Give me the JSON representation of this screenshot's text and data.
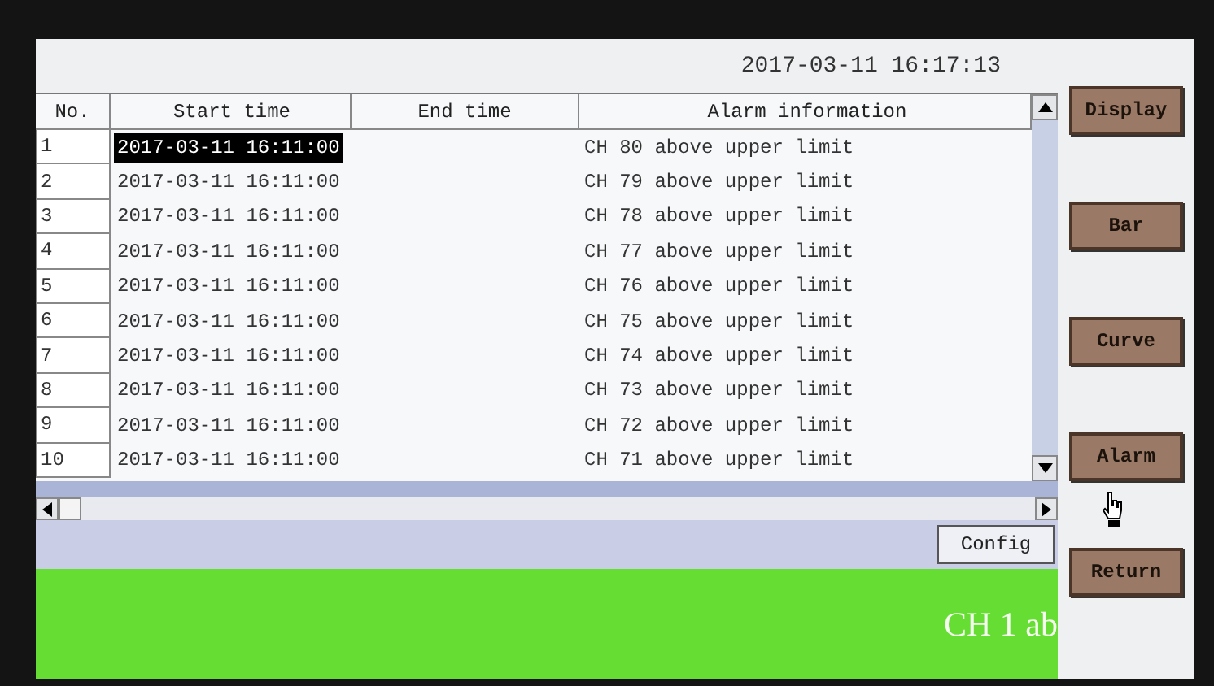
{
  "datetime": "2017-03-11 16:17:13",
  "table": {
    "columns": [
      "No.",
      "Start time",
      "End time",
      "Alarm information"
    ],
    "rows": [
      {
        "no": "1",
        "start": "2017-03-11 16:11:00",
        "info": "CH 80 above upper limit",
        "selected": true
      },
      {
        "no": "2",
        "start": "2017-03-11 16:11:00",
        "info": "CH 79 above upper limit",
        "selected": false
      },
      {
        "no": "3",
        "start": "2017-03-11 16:11:00",
        "info": "CH 78 above upper limit",
        "selected": false
      },
      {
        "no": "4",
        "start": "2017-03-11 16:11:00",
        "info": "CH 77 above upper limit",
        "selected": false
      },
      {
        "no": "5",
        "start": "2017-03-11 16:11:00",
        "info": "CH 76 above upper limit",
        "selected": false
      },
      {
        "no": "6",
        "start": "2017-03-11 16:11:00",
        "info": "CH 75 above upper limit",
        "selected": false
      },
      {
        "no": "7",
        "start": "2017-03-11 16:11:00",
        "info": "CH 74 above upper limit",
        "selected": false
      },
      {
        "no": "8",
        "start": "2017-03-11 16:11:00",
        "info": "CH 73 above upper limit",
        "selected": false
      },
      {
        "no": "9",
        "start": "2017-03-11 16:11:00",
        "info": "CH 72 above upper limit",
        "selected": false
      },
      {
        "no": "10",
        "start": "2017-03-11 16:11:00",
        "info": "CH 71 above upper limit",
        "selected": false
      }
    ]
  },
  "config_button": "Config",
  "marquee": "CH 1 ab",
  "nav_buttons": [
    {
      "label": "Display"
    },
    {
      "label": "Bar"
    },
    {
      "label": "Curve"
    },
    {
      "label": "Alarm"
    },
    {
      "label": "Return"
    }
  ]
}
